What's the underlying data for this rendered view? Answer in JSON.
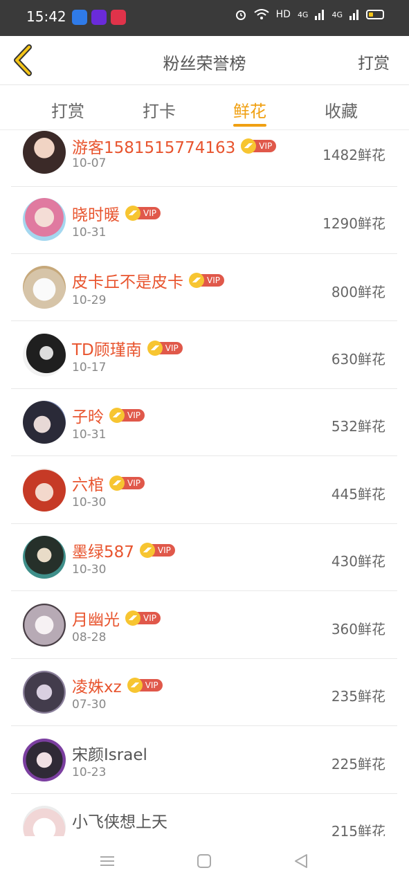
{
  "status_bar": {
    "time": "15:42",
    "network_label": "HD",
    "signal_1": "4G",
    "signal_2": "4G",
    "app_icons": [
      "blue-circle-app-icon",
      "video-app-icon",
      "heart-app-icon"
    ]
  },
  "header": {
    "title": "粉丝荣誉榜",
    "action_label": "打赏",
    "back_icon": "chevron-left-icon"
  },
  "tabs": [
    {
      "label": "打赏",
      "active": false
    },
    {
      "label": "打卡",
      "active": false
    },
    {
      "label": "鲜花",
      "active": true
    },
    {
      "label": "收藏",
      "active": false
    }
  ],
  "vip_label": "VIP",
  "rows": [
    {
      "name": "游客1581515774163",
      "date": "10-07",
      "amount": "1482鲜花",
      "vip": true
    },
    {
      "name": "晓时暖",
      "date": "10-31",
      "amount": "1290鲜花",
      "vip": true
    },
    {
      "name": "皮卡丘不是皮卡",
      "date": "10-29",
      "amount": "800鲜花",
      "vip": true
    },
    {
      "name": "TD顾瑾南",
      "date": "10-17",
      "amount": "630鲜花",
      "vip": true
    },
    {
      "name": "子昤",
      "date": "10-31",
      "amount": "532鲜花",
      "vip": true
    },
    {
      "name": "六棺",
      "date": "10-30",
      "amount": "445鲜花",
      "vip": true
    },
    {
      "name": "墨绿587",
      "date": "10-30",
      "amount": "430鲜花",
      "vip": true
    },
    {
      "name": "月幽光",
      "date": "08-28",
      "amount": "360鲜花",
      "vip": true
    },
    {
      "name": "凌姝xz",
      "date": "07-30",
      "amount": "235鲜花",
      "vip": true
    },
    {
      "name": "宋颜Israel",
      "date": "10-23",
      "amount": "225鲜花",
      "vip": false
    },
    {
      "name": "小飞侠想上天",
      "date": "",
      "amount": "215鲜花",
      "vip": false
    }
  ],
  "colors": {
    "accent": "#f0a012",
    "vip_name": "#e8542e",
    "vip_tag": "#e0584a",
    "crown": "#f7c531"
  },
  "nav": [
    "menu-icon",
    "home-square-icon",
    "back-triangle-icon"
  ]
}
